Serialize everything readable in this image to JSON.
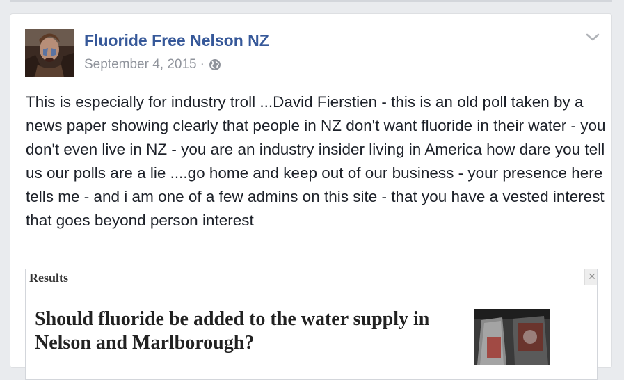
{
  "post": {
    "page_name": "Fluoride Free Nelson NZ",
    "date": "September 4, 2015",
    "separator": "·",
    "privacy_icon": "globe-icon",
    "options_icon": "chevron-down-icon",
    "text": "This is especially for industry troll ...David Fierstien - this is an old poll taken by a news paper showing clearly that people in NZ don't want fluoride in their water - you don't even live in NZ - you are an industry insider living in America how dare you tell us our polls are a lie ....go home and keep out of our business - your presence here tells me - and i am one of a few admins on this site - that you have a vested interest that goes beyond person interest"
  },
  "attachment": {
    "header": "Results",
    "close_label": "×",
    "question": "Should fluoride be added to the water supply in Nelson and Marlborough?"
  },
  "colors": {
    "page_name": "#365899",
    "meta": "#90949c",
    "body_text": "#1d2129",
    "background": "#e9ebee"
  }
}
